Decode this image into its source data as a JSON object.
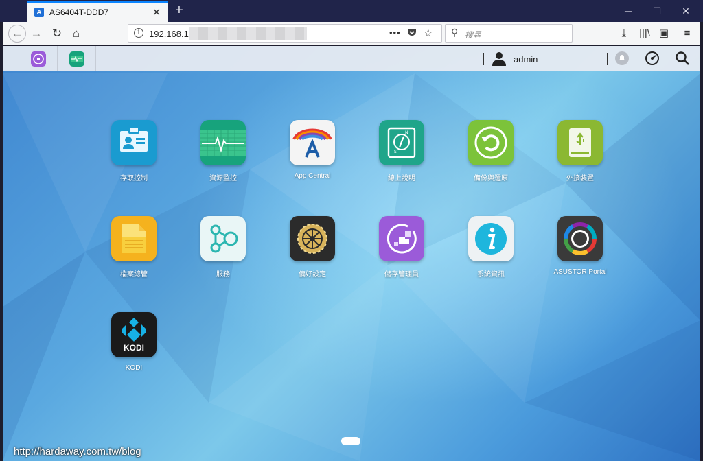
{
  "browser": {
    "tab_title": "AS6404T-DDD7",
    "tab_favicon_letter": "A",
    "url": "192.168.1",
    "search_placeholder": "搜尋",
    "new_tab_glyph": "+",
    "close_glyph": "✕"
  },
  "nas": {
    "user": "admin"
  },
  "apps": [
    {
      "label": "存取控制",
      "icon": "access-control-icon",
      "color": "#1a9bd0"
    },
    {
      "label": "資源監控",
      "icon": "resource-monitor-icon",
      "color": "#17a37c"
    },
    {
      "label": "App Central",
      "icon": "app-central-icon",
      "color": "#f4f4f4"
    },
    {
      "label": "線上說明",
      "icon": "online-help-icon",
      "color": "#1fa58a"
    },
    {
      "label": "備份與還原",
      "icon": "backup-restore-icon",
      "color": "#7cc33a"
    },
    {
      "label": "外接裝置",
      "icon": "external-devices-icon",
      "color": "#8bb832"
    },
    {
      "label": "檔案總管",
      "icon": "file-explorer-icon",
      "color": "#f5b21e"
    },
    {
      "label": "服務",
      "icon": "services-icon",
      "color": "#e9f6f6"
    },
    {
      "label": "偏好設定",
      "icon": "preferences-icon",
      "color": "#2b2b2b"
    },
    {
      "label": "儲存管理員",
      "icon": "storage-manager-icon",
      "color": "#9b5bd9"
    },
    {
      "label": "系統資訊",
      "icon": "system-info-icon",
      "color": "#eef2f4"
    },
    {
      "label": "ASUSTOR Portal",
      "icon": "asustor-portal-icon",
      "color": "#3a3a3a"
    },
    {
      "label": "KODI",
      "icon": "kodi-icon",
      "color": "#1a1a1a"
    }
  ],
  "watermark": "http://hardaway.com.tw/blog"
}
